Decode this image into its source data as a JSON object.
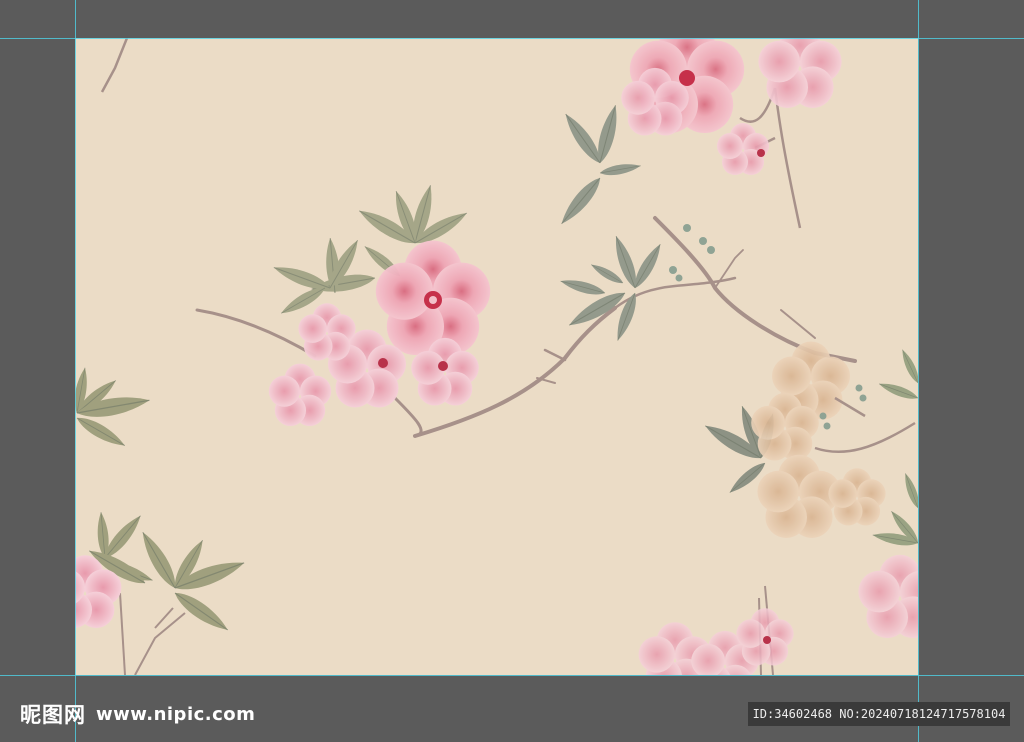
{
  "watermark": {
    "logo_cn": "昵图网",
    "logo_url": "www.nipic.com"
  },
  "image_info": {
    "id_text": "ID:34602468 NO:20240718124717578104"
  },
  "colors": {
    "workspace_bg": "#5b5b5b",
    "artboard_bg": "#ebdcc6",
    "guide_line": "#4fd2e6",
    "blossom_pink": "#f2b8c4",
    "blossom_deep": "#d9697f",
    "blossom_beige": "#e3c4a6",
    "leaf_green": "#9aa383",
    "leaf_gray": "#8c9690",
    "branch": "#a7918a"
  },
  "icons": [
    "plum-blossom-illustration",
    "leaf-sprig",
    "blossom-branch"
  ]
}
